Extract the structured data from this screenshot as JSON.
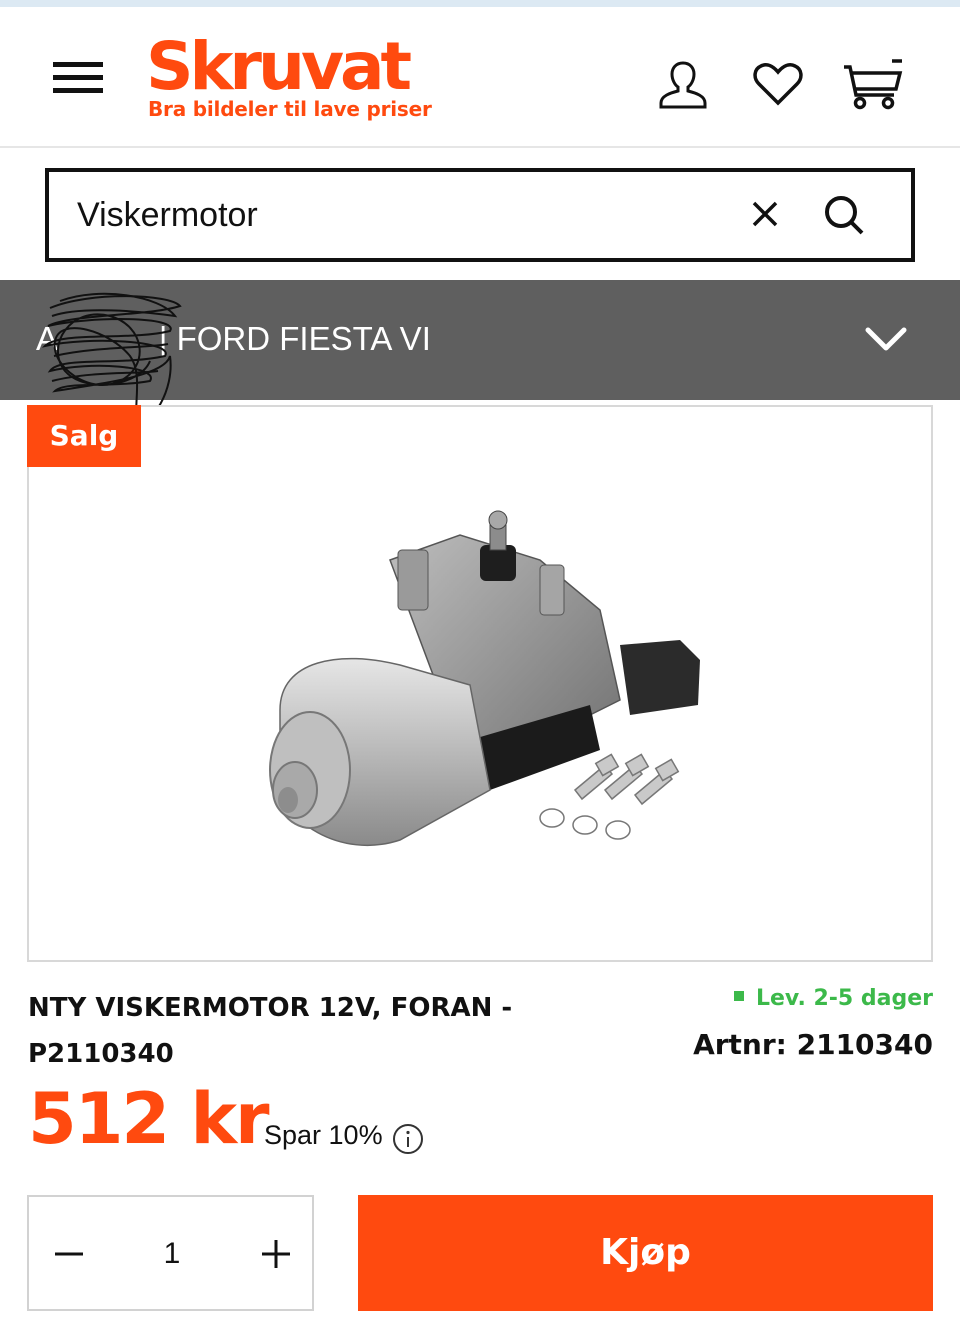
{
  "header": {
    "logo_text": "Skruvat",
    "logo_tagline": "Bra bildeler til lave priser",
    "icons": [
      "menu-icon",
      "user-icon",
      "heart-icon",
      "cart-icon"
    ]
  },
  "search": {
    "value": "Viskermotor",
    "icons": [
      "close-icon",
      "search-icon"
    ]
  },
  "vehicle": {
    "label": "A           | FORD FIESTA VI",
    "icon": "chevron-down-icon"
  },
  "product": {
    "badge": "Salg",
    "title": "NTY VISKERMOTOR 12V, FORAN - P2110340",
    "delivery": "Lev. 2-5 dager",
    "artnr": "Artnr: 2110340",
    "price": "512 kr",
    "saving": "Spar 10%",
    "info_icon": "info-icon"
  },
  "purchase": {
    "quantity": "1",
    "buy_label": "Kjøp"
  },
  "colors": {
    "brand": "#ff4a0f",
    "vehicle_bar": "#5f5f5f",
    "delivery_green": "#3cb94a"
  }
}
